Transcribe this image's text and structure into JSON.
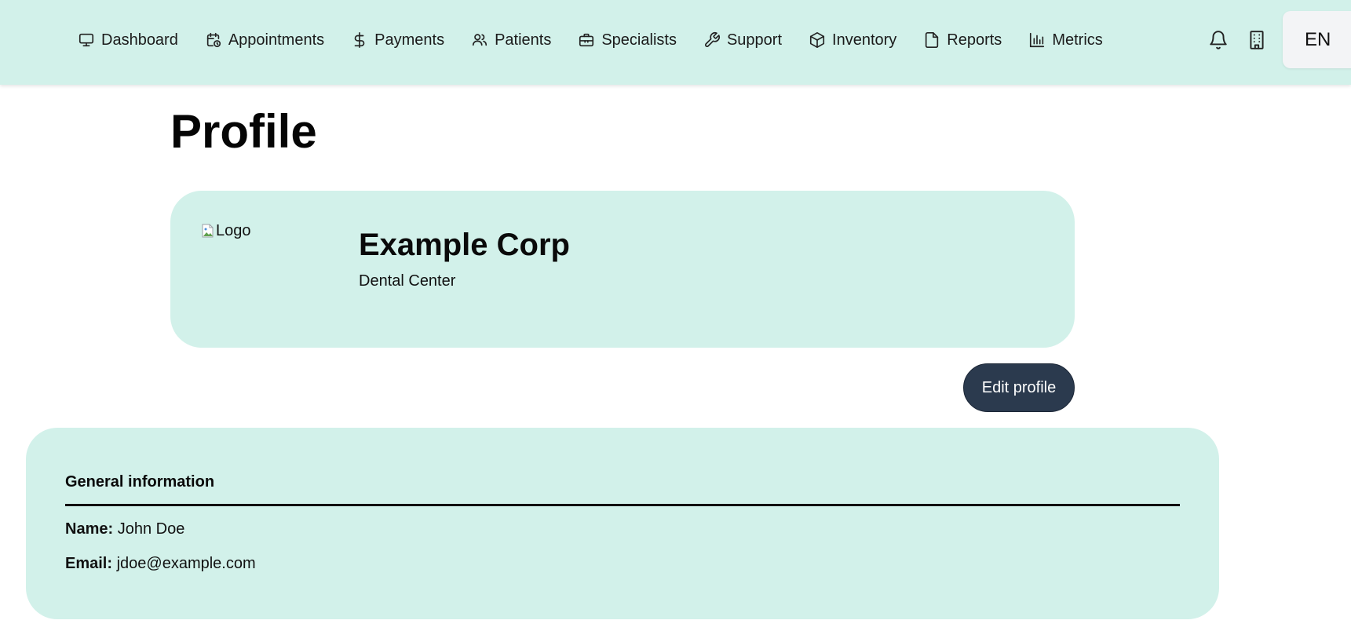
{
  "nav": {
    "items": [
      {
        "label": "Dashboard",
        "icon": "monitor-icon"
      },
      {
        "label": "Appointments",
        "icon": "calendar-clock-icon"
      },
      {
        "label": "Payments",
        "icon": "dollar-icon"
      },
      {
        "label": "Patients",
        "icon": "users-icon"
      },
      {
        "label": "Specialists",
        "icon": "briefcase-icon"
      },
      {
        "label": "Support",
        "icon": "wrench-icon"
      },
      {
        "label": "Inventory",
        "icon": "box-icon"
      },
      {
        "label": "Reports",
        "icon": "file-icon"
      },
      {
        "label": "Metrics",
        "icon": "bar-chart-icon"
      }
    ],
    "right_icons": [
      "bell-icon",
      "building-icon"
    ],
    "language": "EN"
  },
  "page": {
    "title": "Profile"
  },
  "company": {
    "logo_alt": "Logo",
    "name": "Example Corp",
    "type": "Dental Center"
  },
  "actions": {
    "edit_label": "Edit profile"
  },
  "general": {
    "heading": "General information",
    "name_label": "Name:",
    "name_value": "John Doe",
    "email_label": "Email:",
    "email_value": "jdoe@example.com"
  },
  "colors": {
    "mint": "#d2f1ea",
    "button": "#2b3a4e",
    "lang_bg": "#f3f4f6"
  }
}
